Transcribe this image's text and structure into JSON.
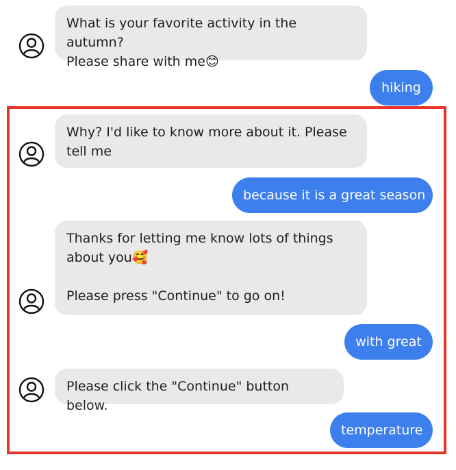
{
  "conversation": {
    "messages": [
      {
        "sender": "bot",
        "lines": [
          "What is your favorite activity in the autumn?",
          "Please share with me😊"
        ]
      },
      {
        "sender": "user",
        "text": "hiking"
      },
      {
        "sender": "bot",
        "lines": [
          "Why? I'd like to know more about it. Please",
          "tell me"
        ]
      },
      {
        "sender": "user",
        "text": "because it is a great season"
      },
      {
        "sender": "bot",
        "lines": [
          "Thanks for letting me know lots of things",
          "about you🥰",
          "",
          "Please press \"Continue\" to go on!"
        ]
      },
      {
        "sender": "user",
        "text": "with great"
      },
      {
        "sender": "bot",
        "lines": [
          "Please click the \"Continue\" button below."
        ]
      },
      {
        "sender": "user",
        "text": "temperature"
      }
    ]
  },
  "colors": {
    "user_bubble": "#3d7fed",
    "bot_bubble": "#e9e9eb",
    "highlight_border": "#e7342a"
  },
  "icons": {
    "avatar": "user-avatar-icon"
  }
}
